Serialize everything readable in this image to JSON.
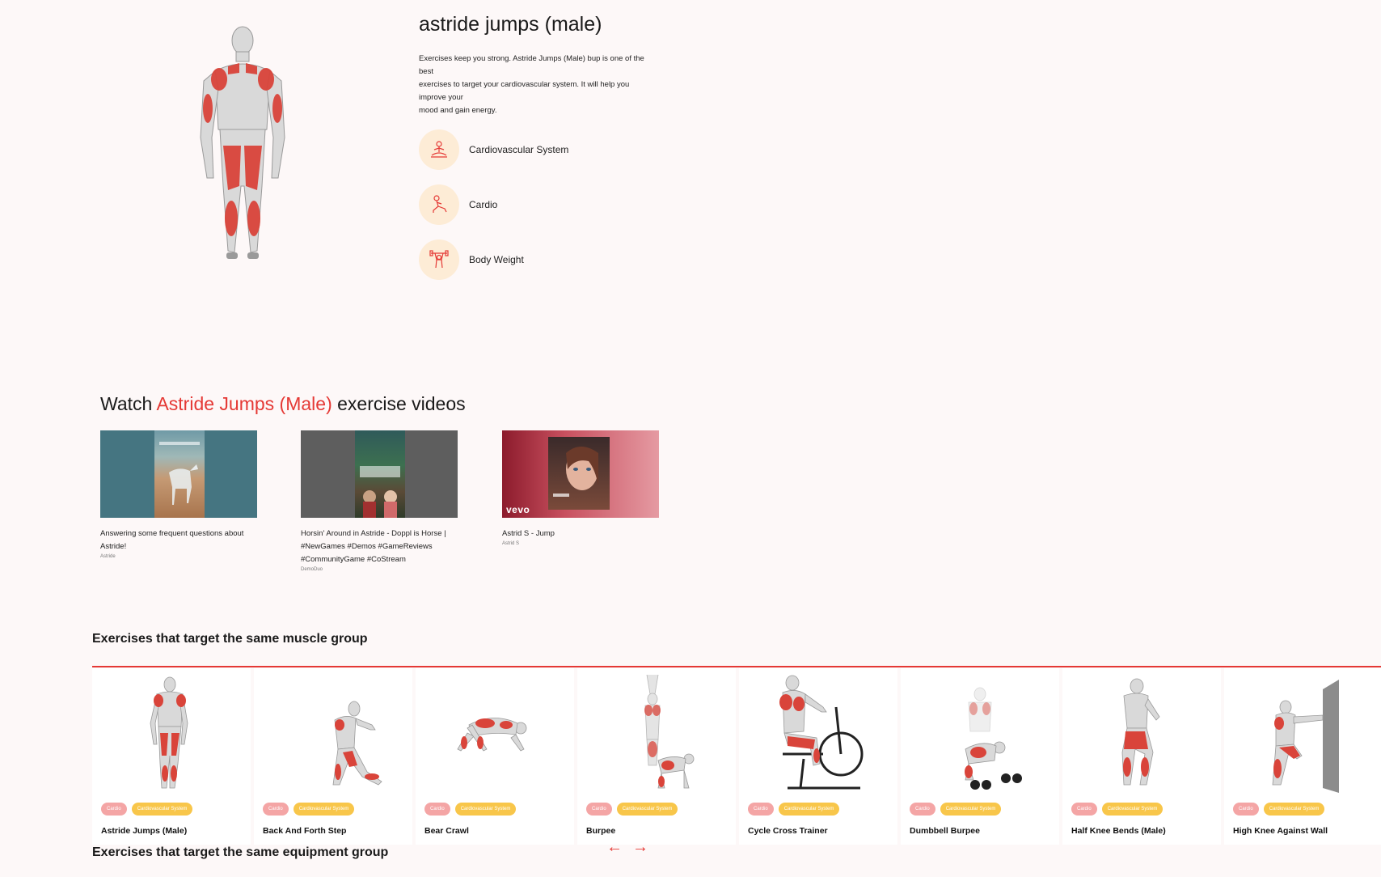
{
  "exercise": {
    "title": "astride jumps (male)",
    "description_lines": [
      "Exercises keep you strong. Astride Jumps (Male) bup is one of the",
      "best",
      "exercises to target your cardiovascular system. It will help you",
      "improve your",
      "mood and gain energy."
    ],
    "attributes": [
      {
        "label": "Cardiovascular System",
        "icon": "meditation-icon"
      },
      {
        "label": "Cardio",
        "icon": "lunge-stretch-icon"
      },
      {
        "label": "Body Weight",
        "icon": "dumbbell-lift-icon"
      }
    ]
  },
  "videos_section": {
    "title_prefix": "Watch ",
    "title_accent": "Astride Jumps (Male)",
    "title_suffix": " exercise videos",
    "videos": [
      {
        "title_lines": [
          "Answering some frequent questions about",
          "Astride!"
        ],
        "channel": "Astride"
      },
      {
        "title_lines": [
          "Horsin' Around in Astride - Doppl is Horse |",
          "#NewGames #Demos #GameReviews",
          "#CommunityGame #CoStream"
        ],
        "channel": "DemoDuo"
      },
      {
        "title_lines": [
          "Astrid S - Jump"
        ],
        "channel": "Astrid S",
        "thumb_brand": "vevo"
      }
    ]
  },
  "related": {
    "title": "Exercises that target the same muscle group",
    "cards": [
      {
        "name": "Astride Jumps (Male)",
        "tags": [
          "Cardio",
          "Cardiovascular System"
        ]
      },
      {
        "name": "Back And Forth Step",
        "tags": [
          "Cardio",
          "Cardiovascular System"
        ]
      },
      {
        "name": "Bear Crawl",
        "tags": [
          "Cardio",
          "Cardiovascular System"
        ]
      },
      {
        "name": "Burpee",
        "tags": [
          "Cardio",
          "Cardiovascular System"
        ]
      },
      {
        "name": "Cycle Cross Trainer",
        "tags": [
          "Cardio",
          "Cardiovascular System"
        ]
      },
      {
        "name": "Dumbbell Burpee",
        "tags": [
          "Cardio",
          "Cardiovascular System"
        ]
      },
      {
        "name": "Half Knee Bends (Male)",
        "tags": [
          "Cardio",
          "Cardiovascular System"
        ]
      },
      {
        "name": "High Knee Against Wall",
        "tags": [
          "Cardio",
          "Cardiovascular System"
        ]
      }
    ],
    "prev_arrow": "←",
    "next_arrow": "→"
  },
  "equipment": {
    "title": "Exercises that target the same equipment group"
  },
  "colors": {
    "accent": "#e53935",
    "muscle": "#d9443a",
    "tag_pink": "#f4a5a5",
    "tag_yellow": "#f8c64a",
    "icon_bg": "#fdecd6"
  }
}
